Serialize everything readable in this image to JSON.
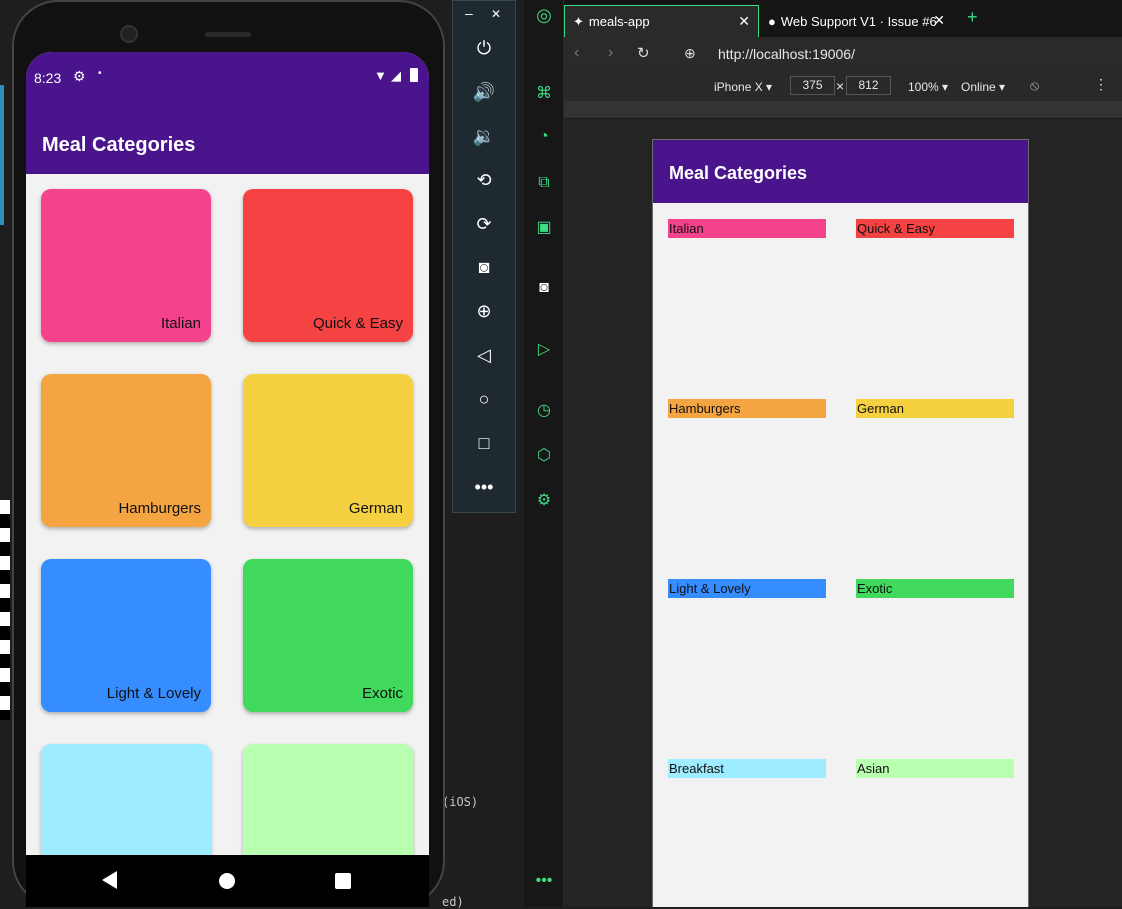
{
  "phone": {
    "time": "8:23",
    "app_title": "Meal Categories",
    "categories": [
      {
        "label": "Italian",
        "color": "#f5428d"
      },
      {
        "label": "Quick & Easy",
        "color": "#f54242"
      },
      {
        "label": "Hamburgers",
        "color": "#f5a442"
      },
      {
        "label": "German",
        "color": "#f5d142"
      },
      {
        "label": "Light & Lovely",
        "color": "#368dff"
      },
      {
        "label": "Exotic",
        "color": "#41d95d"
      },
      {
        "label": "",
        "color": "#9eecff"
      },
      {
        "label": "",
        "color": "#b9ffb0"
      }
    ]
  },
  "emulator": {
    "minimize": "–",
    "close": "✕",
    "buttons": [
      "power-icon",
      "volume-up-icon",
      "volume-down-icon",
      "rotate-left-icon",
      "rotate-right-icon",
      "camera-icon",
      "zoom-icon",
      "back-icon",
      "home-icon",
      "overview-icon",
      "more-icon"
    ]
  },
  "browser": {
    "tabs": [
      {
        "title": "meals-app"
      },
      {
        "title": "Web Support V1 · Issue #6"
      }
    ],
    "new_tab": "+",
    "url": "http://localhost:19006/",
    "device": "iPhone X ▾",
    "width": "375",
    "height": "812",
    "times": "×",
    "zoom": "100% ▾",
    "network": "Online ▾"
  },
  "web": {
    "title": "Meal Categories",
    "categories": [
      {
        "label": "Italian",
        "color": "#f5428d"
      },
      {
        "label": "Quick & Easy",
        "color": "#f54242"
      },
      {
        "label": "Hamburgers",
        "color": "#f5a442"
      },
      {
        "label": "German",
        "color": "#f5d142"
      },
      {
        "label": "Light & Lovely",
        "color": "#368dff"
      },
      {
        "label": "Exotic",
        "color": "#41d95d"
      },
      {
        "label": "Breakfast",
        "color": "#9eecff"
      },
      {
        "label": "Asian",
        "color": "#b9ffb0"
      }
    ]
  },
  "background": {
    "snippets": [
      "(iOS)",
      "ed)"
    ]
  }
}
